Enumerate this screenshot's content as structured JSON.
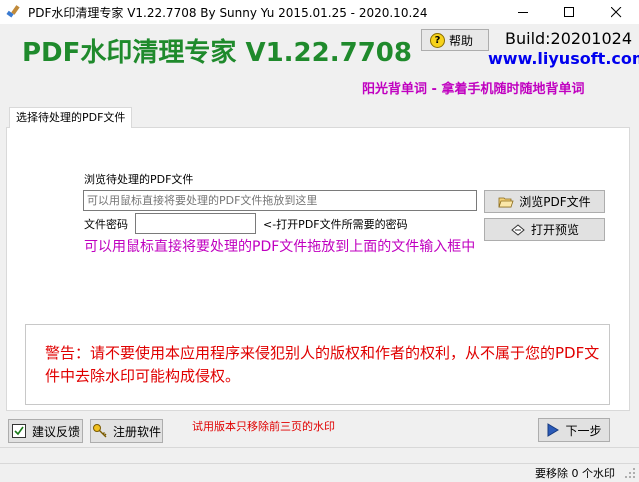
{
  "window": {
    "title": "PDF水印清理专家 V1.22.7708 By Sunny Yu 2015.01.25 - 2020.10.24"
  },
  "header": {
    "app_title": "PDF水印清理专家 V1.22.7708",
    "help_label": "帮助",
    "build": "Build:20201024",
    "website": "www.liyusoft.com",
    "slogan": "阳光背单词 - 拿着手机随时随地背单词"
  },
  "tabs": [
    {
      "label": "选择待处理的PDF文件"
    }
  ],
  "form": {
    "browse_label": "浏览待处理的PDF文件",
    "file_placeholder": "可以用鼠标直接将要处理的PDF文件拖放到这里",
    "password_label": "文件密码",
    "password_value": "",
    "password_hint": "<-打开PDF文件所需要的密码",
    "browse_button": "浏览PDF文件",
    "preview_button": "打开预览",
    "drag_hint": "可以用鼠标直接将要处理的PDF文件拖放到上面的文件输入框中"
  },
  "warning": "警告：请不要使用本应用程序来侵犯别人的版权和作者的权利，从不属于您的PDF文件中去除水印可能构成侵权。",
  "footer": {
    "feedback_button": "建议反馈",
    "register_button": "注册软件",
    "trial_notice": "试用版本只移除前三页的水印",
    "next_button": "下一步"
  },
  "statusbar": {
    "text": "要移除 0 个水印"
  },
  "colors": {
    "title_green": "#1f8a2c",
    "link_blue": "#0000ee",
    "accent_magenta": "#c000c0",
    "warning_red": "#e00000"
  }
}
